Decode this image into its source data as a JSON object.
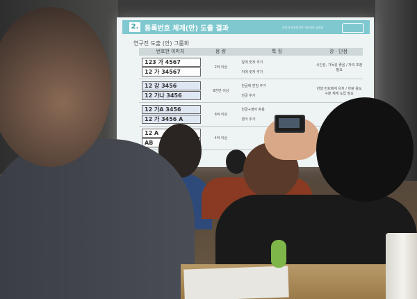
{
  "slide": {
    "number": "2.",
    "title": "등록번호 체계(안) 도출 결과",
    "subtitle": "자동차 등록번호판 개선방안 공청회",
    "section_label": "연구진 도출 (안) 그룹화",
    "headers": [
      "번호판 이미지",
      "용 량",
      "특 징",
      "장 · 단점"
    ],
    "groups": [
      {
        "plates": [
          "123 가 4567",
          "12 가 34567"
        ],
        "capacity": "2억 이상",
        "features": [
          "앞에 숫자 추가",
          "뒤에 숫자 추가"
        ],
        "pros_cons": "시인성, 가독성 좋음 / 자리 조정 필요"
      },
      {
        "plates": [
          "12 강 3456",
          "12 가나 3456"
        ],
        "capacity": "8천만 이상",
        "features": [
          "한글에 받침 추가",
          "한글 추가"
        ],
        "pros_cons": "현행 번호체계 유지 / 차량 용도구분 체계 도입 필요"
      },
      {
        "plates": [
          "12 가A 3456",
          "12 가 3456 A"
        ],
        "capacity": "8억 이상",
        "features": [
          "한글+영어 혼용",
          "영어 추가"
        ],
        "pros_cons": ""
      },
      {
        "plates": [
          "12 A",
          "AB"
        ],
        "capacity": "4억 이상",
        "features": [
          "",
          ""
        ],
        "pros_cons": ""
      }
    ]
  },
  "colors": {
    "header_teal": "#7fc8cf",
    "screen_bg": "#eef3f4"
  }
}
